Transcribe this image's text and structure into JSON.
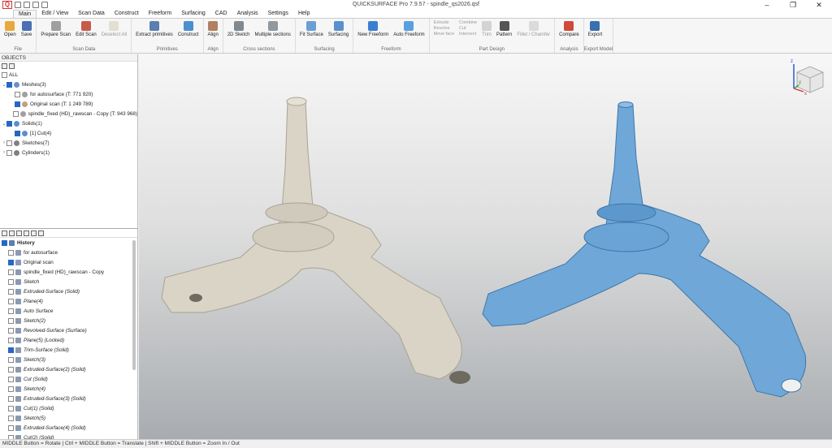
{
  "window": {
    "title": "QUICKSURFACE Pro 7.9.57 - spindle_qs2026.qsf",
    "app_icon": "Q",
    "controls": [
      "–",
      "❐",
      "✕"
    ]
  },
  "menu": {
    "tabs": [
      "Main",
      "Edit / View",
      "Scan Data",
      "Construct",
      "Freeform",
      "Surfacing",
      "CAD",
      "Analysis",
      "Settings",
      "Help"
    ],
    "active": "Main"
  },
  "ribbon": {
    "groups": [
      {
        "label": "File",
        "buttons": [
          {
            "label": "Open",
            "icon": "folder-icon",
            "color": "#e8a93a"
          },
          {
            "label": "Save",
            "icon": "floppy-icon",
            "color": "#4a6fb5"
          }
        ]
      },
      {
        "label": "Scan Data",
        "buttons": [
          {
            "label": "Prepare Scan",
            "icon": "prepare-scan-icon",
            "color": "#a0a0a0"
          },
          {
            "label": "Edit Scan",
            "icon": "edit-scan-icon",
            "color": "#c85a4a"
          },
          {
            "label": "Deselect All",
            "icon": "deselect-icon",
            "color": "#d0c8b0",
            "disabled": true
          }
        ]
      },
      {
        "label": "Primitives",
        "buttons": [
          {
            "label": "Extract primitives",
            "icon": "extract-primitives-icon",
            "color": "#5a7fb0"
          },
          {
            "label": "Construct",
            "icon": "construct-icon",
            "color": "#4a8fd0"
          }
        ]
      },
      {
        "label": "Align",
        "buttons": [
          {
            "label": "Align",
            "icon": "align-icon",
            "color": "#b08060"
          }
        ]
      },
      {
        "label": "Cross sections",
        "buttons": [
          {
            "label": "2D Sketch",
            "icon": "sketch-icon",
            "color": "#808890"
          },
          {
            "label": "Multiple sections",
            "icon": "sections-icon",
            "color": "#9098a0"
          }
        ]
      },
      {
        "label": "Surfacing",
        "buttons": [
          {
            "label": "Fit Surface",
            "icon": "fit-surface-icon",
            "color": "#6a9fd8"
          },
          {
            "label": "Surfacing",
            "icon": "surfacing-icon",
            "color": "#5a8fd0"
          }
        ]
      },
      {
        "label": "Freeform",
        "buttons": [
          {
            "label": "New Freeform",
            "icon": "new-freeform-icon",
            "color": "#3a7fd0"
          },
          {
            "label": "Auto Freeform",
            "icon": "auto-freeform-icon",
            "color": "#5a9fe0"
          }
        ]
      },
      {
        "label": "Part Design",
        "small": [
          [
            "Extrude",
            "Revolve",
            "Move face"
          ],
          [
            "Combine",
            "Cut",
            "Intersect"
          ]
        ],
        "buttons": [
          {
            "label": "Trim",
            "icon": "trim-icon",
            "color": "#b0b0b0",
            "disabled": true
          },
          {
            "label": "Pattern",
            "icon": "pattern-icon",
            "color": "#555555"
          },
          {
            "label": "Fillet / Chamfer",
            "icon": "fillet-icon",
            "color": "#c0c0c0",
            "disabled": true
          }
        ]
      },
      {
        "label": "Analysis",
        "buttons": [
          {
            "label": "Compare",
            "icon": "compare-icon",
            "color": "#d04a3a"
          }
        ]
      },
      {
        "label": "Export Model",
        "buttons": [
          {
            "label": "Export",
            "icon": "export-icon",
            "color": "#3a6fb0"
          }
        ]
      }
    ]
  },
  "objects": {
    "title": "OBJECTS",
    "all_label": "ALL",
    "rows": [
      {
        "label": "Meshes(3)",
        "level": 0,
        "expanded": true,
        "checked": true,
        "icon_color": "#6a90c8"
      },
      {
        "label": "for autosurface (T: 771 920)",
        "level": 1,
        "checked": false,
        "icon_color": "#a0a0a0"
      },
      {
        "label": "Original scan (T: 1 249 789)",
        "level": 1,
        "checked": true,
        "icon_color": "#c0a080"
      },
      {
        "label": "spindle_fixed (HD)_rawscan - Copy (T: 943 968)",
        "level": 1,
        "checked": false,
        "icon_color": "#a0a0a0"
      },
      {
        "label": "Solids(1)",
        "level": 0,
        "expanded": true,
        "checked": true,
        "icon_color": "#5a8fd0"
      },
      {
        "label": "[1] Cut(4)",
        "level": 1,
        "checked": true,
        "icon_color": "#5a8fd0"
      },
      {
        "label": "Sketches(7)",
        "level": 0,
        "expanded": false,
        "checked": false,
        "icon_color": "#808080"
      },
      {
        "label": "Cylinders(1)",
        "level": 0,
        "expanded": false,
        "checked": false,
        "icon_color": "#808080"
      }
    ]
  },
  "history": {
    "title": "History",
    "rows": [
      {
        "label": "for autosurface",
        "checked": false,
        "italic": false
      },
      {
        "label": "Original scan",
        "checked": true,
        "italic": false
      },
      {
        "label": "spindle_fixed (HD)_rawscan - Copy",
        "checked": false,
        "italic": false
      },
      {
        "label": "Sketch",
        "checked": false,
        "italic": true
      },
      {
        "label": "Extruded-Surface (Solid)",
        "checked": false,
        "italic": true
      },
      {
        "label": "Plane(4)",
        "checked": false,
        "italic": true
      },
      {
        "label": "Auto Surface",
        "checked": false,
        "italic": true
      },
      {
        "label": "Sketch(2)",
        "checked": false,
        "italic": true
      },
      {
        "label": "Revolved-Surface (Surface)",
        "checked": false,
        "italic": true
      },
      {
        "label": "Plane(5) (Locked)",
        "checked": false,
        "italic": true
      },
      {
        "label": "Trim-Surface (Solid)",
        "checked": true,
        "italic": true
      },
      {
        "label": "Sketch(3)",
        "checked": false,
        "italic": true
      },
      {
        "label": "Extruded-Surface(2) (Solid)",
        "checked": false,
        "italic": true
      },
      {
        "label": "Cut (Solid)",
        "checked": false,
        "italic": true
      },
      {
        "label": "Sketch(4)",
        "checked": false,
        "italic": true
      },
      {
        "label": "Extruded-Surface(3) (Solid)",
        "checked": false,
        "italic": true
      },
      {
        "label": "Cut(1) (Solid)",
        "checked": false,
        "italic": true
      },
      {
        "label": "Sketch(5)",
        "checked": false,
        "italic": true
      },
      {
        "label": "Extruded-Surface(4) (Solid)",
        "checked": false,
        "italic": true
      },
      {
        "label": "Cut(2) (Solid)",
        "checked": false,
        "italic": true
      }
    ]
  },
  "viewport": {
    "axis_labels": [
      "z",
      "y",
      "x"
    ],
    "mesh_color": "#d9d4c6",
    "solid_color": "#6fa8d8"
  },
  "status": {
    "text": "MIDDLE Button = Rotate | Ctrl + MIDDLE Button = Translate | Shift + MIDDLE Button = Zoom In / Out"
  }
}
